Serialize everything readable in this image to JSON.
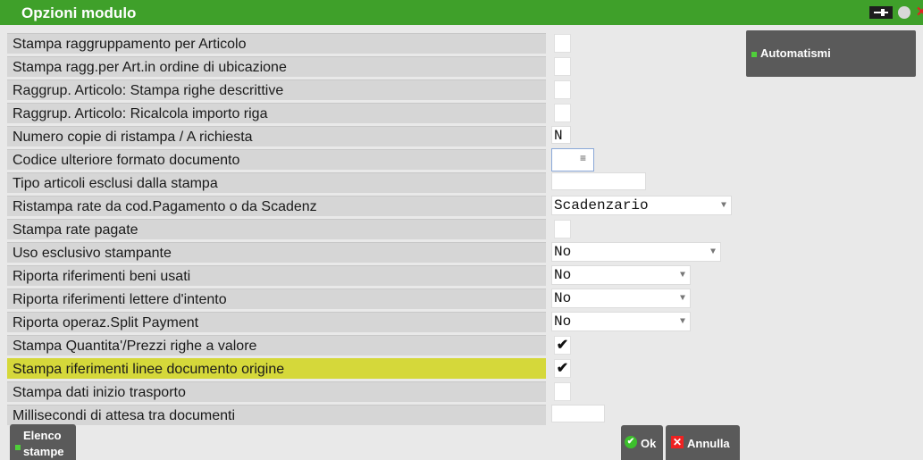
{
  "window": {
    "title": "Opzioni modulo"
  },
  "sidebar": {
    "automatismi_label": "Automatismi"
  },
  "rows": [
    {
      "label": "Stampa raggruppamento per Articolo"
    },
    {
      "label": "Stampa ragg.per Art.in ordine di ubicazione"
    },
    {
      "label": "Raggrup. Articolo: Stampa righe descrittive"
    },
    {
      "label": "Raggrup. Articolo: Ricalcola importo riga"
    },
    {
      "label": "Numero copie di ristampa / A richiesta",
      "value": "N"
    },
    {
      "label": "Codice ulteriore formato documento",
      "value": ""
    },
    {
      "label": "Tipo articoli esclusi dalla stampa",
      "value": ""
    },
    {
      "label": "Ristampa rate da cod.Pagamento o da Scadenz",
      "value": "Scadenzario"
    },
    {
      "label": "Stampa rate pagate"
    },
    {
      "label": "Uso esclusivo stampante",
      "value": "No"
    },
    {
      "label": "Riporta riferimenti beni usati",
      "value": "No"
    },
    {
      "label": "Riporta riferimenti lettere d'intento",
      "value": "No"
    },
    {
      "label": "Riporta operaz.Split Payment",
      "value": "No"
    },
    {
      "label": "Stampa Quantita'/Prezzi righe a valore",
      "check": "✔"
    },
    {
      "label": "Stampa riferimenti linee documento origine",
      "check": "✔"
    },
    {
      "label": "Stampa dati inizio trasporto"
    },
    {
      "label": "Millisecondi di attesa tra documenti",
      "value": ""
    }
  ],
  "footer": {
    "elenco_line1": "Elenco",
    "elenco_line2": "stampe",
    "ok_label": "Ok",
    "annulla_label": "Annulla"
  },
  "icons": {
    "pin": "pin-icon",
    "circle": "circle-icon",
    "close": "close-icon",
    "ok": "check-circle-icon",
    "cancel": "x-square-icon",
    "menu": "menu-lines-icon",
    "dropdown": "caret-down-icon"
  },
  "colors": {
    "titlebar": "#3fa02a",
    "highlight": "#d5d83a",
    "button": "#5a5a5a",
    "accent_green": "#4fcf3a",
    "cancel_red": "#e22222"
  }
}
